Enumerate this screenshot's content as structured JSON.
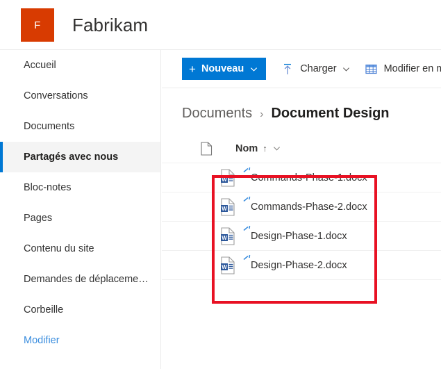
{
  "header": {
    "logo_letter": "F",
    "logo_color": "#d83b01",
    "site_title": "Fabrikam"
  },
  "sidebar": {
    "items": [
      {
        "label": "Accueil",
        "selected": false
      },
      {
        "label": "Conversations",
        "selected": false
      },
      {
        "label": "Documents",
        "selected": false
      },
      {
        "label": "Partagés avec nous",
        "selected": true
      },
      {
        "label": "Bloc-notes",
        "selected": false
      },
      {
        "label": "Pages",
        "selected": false
      },
      {
        "label": "Contenu du site",
        "selected": false
      },
      {
        "label": "Demandes de déplaceme…",
        "selected": false
      },
      {
        "label": "Corbeille",
        "selected": false
      }
    ],
    "edit_link": "Modifier",
    "selected_accent_color": "#0078d4",
    "link_color": "#3a8dde"
  },
  "command_bar": {
    "new_button": {
      "label": "Nouveau",
      "plus": "+",
      "icon": "plus-icon",
      "chevron": "chevron-down-icon",
      "color": "#0078d4"
    },
    "upload": {
      "label": "Charger",
      "icon": "upload-icon",
      "chevron": "chevron-down-icon"
    },
    "grid_edit": {
      "label": "Modifier en m",
      "icon": "grid-icon"
    }
  },
  "breadcrumb": {
    "parent": "Documents",
    "separator": "›",
    "current": "Document Design"
  },
  "list": {
    "type_column_icon": "document-icon",
    "name_column": "Nom",
    "sort_arrow": "↑",
    "sort_chevron": "chevron-down-icon",
    "files": [
      {
        "name": "Commands-Phase-1.docx",
        "icon": "word-document-icon",
        "badge": "new-item-sparkle-icon"
      },
      {
        "name": "Commands-Phase-2.docx",
        "icon": "word-document-icon",
        "badge": "new-item-sparkle-icon"
      },
      {
        "name": "Design-Phase-1.docx",
        "icon": "word-document-icon",
        "badge": "new-item-sparkle-icon"
      },
      {
        "name": "Design-Phase-2.docx",
        "icon": "word-document-icon",
        "badge": "new-item-sparkle-icon"
      }
    ]
  },
  "annotation": {
    "shape": "rectangle-highlight",
    "color": "#e81123"
  }
}
